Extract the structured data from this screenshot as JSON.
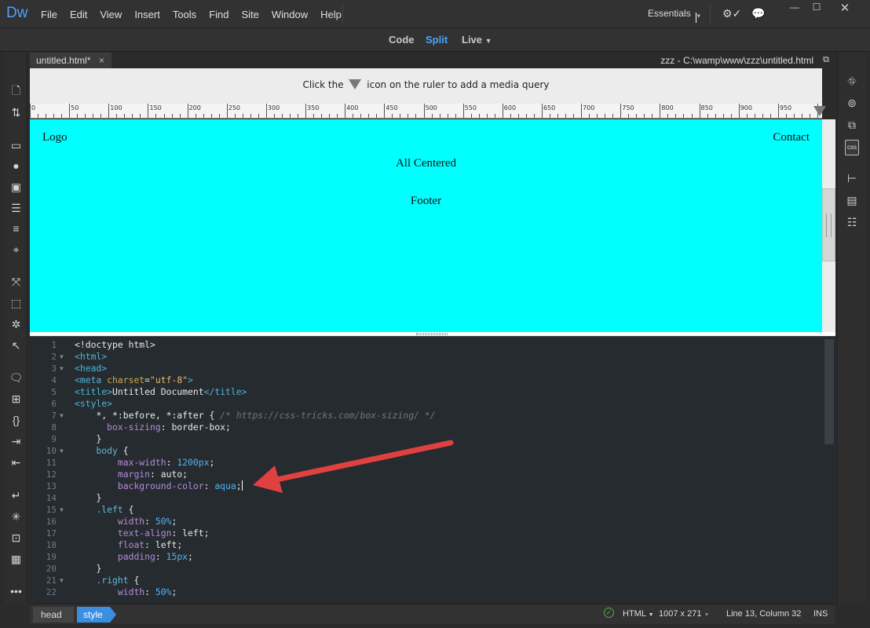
{
  "app": {
    "logo": "Dw"
  },
  "menu": [
    "File",
    "Edit",
    "View",
    "Insert",
    "Tools",
    "Find",
    "Site",
    "Window",
    "Help"
  ],
  "workspace": {
    "label": "Essentials"
  },
  "views": {
    "code": "Code",
    "split": "Split",
    "live": "Live",
    "active": "Split"
  },
  "tab": {
    "name": "untitled.html*",
    "close": "×",
    "path": "zzz - C:\\wamp\\www\\zzz\\untitled.html"
  },
  "mq_hint": {
    "before": "Click the",
    "after": "icon on the ruler to add a media query"
  },
  "ruler": {
    "labels": [
      "0",
      "50",
      "100",
      "150",
      "200",
      "250",
      "300",
      "350",
      "400",
      "450",
      "500",
      "550",
      "600",
      "650",
      "700",
      "750",
      "800",
      "850",
      "900",
      "950"
    ]
  },
  "design": {
    "logo": "Logo",
    "contact": "Contact",
    "centered": "All Centered",
    "footer": "Footer",
    "background": "#00ffff"
  },
  "code": {
    "lines": [
      {
        "n": "1",
        "fold": "",
        "html": "<span class='v'>&lt;!doctype html&gt;</span>"
      },
      {
        "n": "2",
        "fold": "▼",
        "html": "<span class='t'>&lt;html&gt;</span>"
      },
      {
        "n": "3",
        "fold": "▼",
        "html": "<span class='t'>&lt;head&gt;</span>"
      },
      {
        "n": "4",
        "fold": "",
        "html": "<span class='t'>&lt;meta</span> <span class='a'>charset</span><span class='v'>=</span><span class='s'>\"utf-8\"</span><span class='t'>&gt;</span>"
      },
      {
        "n": "5",
        "fold": "",
        "html": "<span class='t'>&lt;title&gt;</span><span class='v'>Untitled Document</span><span class='t'>&lt;/title&gt;</span>"
      },
      {
        "n": "6",
        "fold": "",
        "html": "<span class='t'>&lt;style&gt;</span>"
      },
      {
        "n": "7",
        "fold": "▼",
        "html": "    <span class='v'>*, *:before, *:after {</span> <span class='c'>/* https://css-tricks.com/box-sizing/ */</span>"
      },
      {
        "n": "8",
        "fold": "",
        "html": "      <span class='p'>box-sizing</span><span class='v'>: border-box;</span>"
      },
      {
        "n": "9",
        "fold": "",
        "html": "    <span class='v'>}</span>"
      },
      {
        "n": "10",
        "fold": "▼",
        "html": "    <span class='sel'>body</span> <span class='v'>{</span>"
      },
      {
        "n": "11",
        "fold": "",
        "html": "        <span class='p'>max-width</span><span class='v'>: </span><span class='n'>1200px</span><span class='v'>;</span>"
      },
      {
        "n": "12",
        "fold": "",
        "html": "        <span class='p'>margin</span><span class='v'>: auto;</span>"
      },
      {
        "n": "13",
        "fold": "",
        "html": "        <span class='p'>background-color</span><span class='v'>: </span><span class='n'>aqua</span><span class='v'>;</span><span class='caret'></span>"
      },
      {
        "n": "14",
        "fold": "",
        "html": "    <span class='v'>}</span>"
      },
      {
        "n": "15",
        "fold": "▼",
        "html": "    <span class='sel'>.left</span> <span class='v'>{</span>"
      },
      {
        "n": "16",
        "fold": "",
        "html": "        <span class='p'>width</span><span class='v'>: </span><span class='n'>50%</span><span class='v'>;</span>"
      },
      {
        "n": "17",
        "fold": "",
        "html": "        <span class='p'>text-align</span><span class='v'>: left;</span>"
      },
      {
        "n": "18",
        "fold": "",
        "html": "        <span class='p'>float</span><span class='v'>: left;</span>"
      },
      {
        "n": "19",
        "fold": "",
        "html": "        <span class='p'>padding</span><span class='v'>: </span><span class='n'>15px</span><span class='v'>;</span>"
      },
      {
        "n": "20",
        "fold": "",
        "html": "    <span class='v'>}</span>"
      },
      {
        "n": "21",
        "fold": "▼",
        "html": "    <span class='sel'>.right</span> <span class='v'>{</span>"
      },
      {
        "n": "22",
        "fold": "",
        "html": "        <span class='p'>width</span><span class='v'>: </span><span class='n'>50%</span><span class='v'>;</span>"
      }
    ]
  },
  "status": {
    "crumbs": [
      "head",
      "style"
    ],
    "doc_type": "HTML",
    "size": "1007 x 271",
    "position": "Line 13, Column 32",
    "mode": "INS"
  },
  "colors": {
    "accent": "#4aa3ff",
    "annotation_arrow": "#e04040"
  }
}
